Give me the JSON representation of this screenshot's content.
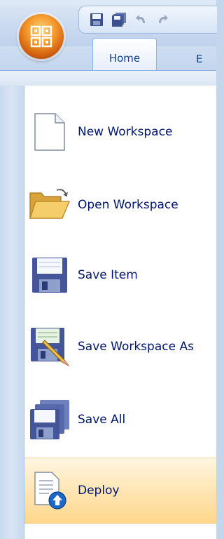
{
  "app_menu": {
    "orb_icon": "office-orb-icon",
    "items": [
      {
        "label": "New Workspace",
        "icon": "new-document-icon"
      },
      {
        "label": "Open Workspace",
        "icon": "open-folder-icon"
      },
      {
        "label": "Save Item",
        "icon": "save-icon"
      },
      {
        "label": "Save Workspace As",
        "icon": "save-as-icon"
      },
      {
        "label": "Save All",
        "icon": "save-all-icon"
      },
      {
        "label": "Deploy",
        "icon": "deploy-icon"
      }
    ],
    "hovered_item": "Deploy"
  },
  "quick_access": {
    "buttons": [
      "save-icon",
      "save-all-icon",
      "undo-icon",
      "redo-icon"
    ]
  },
  "ribbon": {
    "tabs": [
      {
        "label": "Home",
        "active": true
      },
      {
        "label": "E"
      }
    ]
  },
  "colors": {
    "menu_text": "#00156e",
    "tab_text": "#15428b",
    "hover_highlight": "#ffe7b8",
    "frame_blue": "#c4d6ec"
  }
}
